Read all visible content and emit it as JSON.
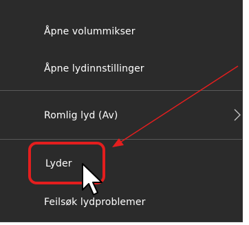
{
  "menu": {
    "items": [
      {
        "label": "Åpne volummikser"
      },
      {
        "label": "Åpne lydinnstillinger"
      },
      {
        "label": "Romlig lyd (Av)",
        "has_submenu": true
      },
      {
        "label": "Lyder",
        "highlighted": true
      },
      {
        "label": "Feilsøk lydproblemer"
      }
    ],
    "colors": {
      "background": "#2b2b2b",
      "text": "#ffffff",
      "separator": "#5a5a5a",
      "annotation": "#e41e1e"
    }
  },
  "icons": {
    "submenu": "chevron-right-icon",
    "pointer": "mouse-cursor-icon",
    "annotation_arrow": "arrow-icon"
  }
}
